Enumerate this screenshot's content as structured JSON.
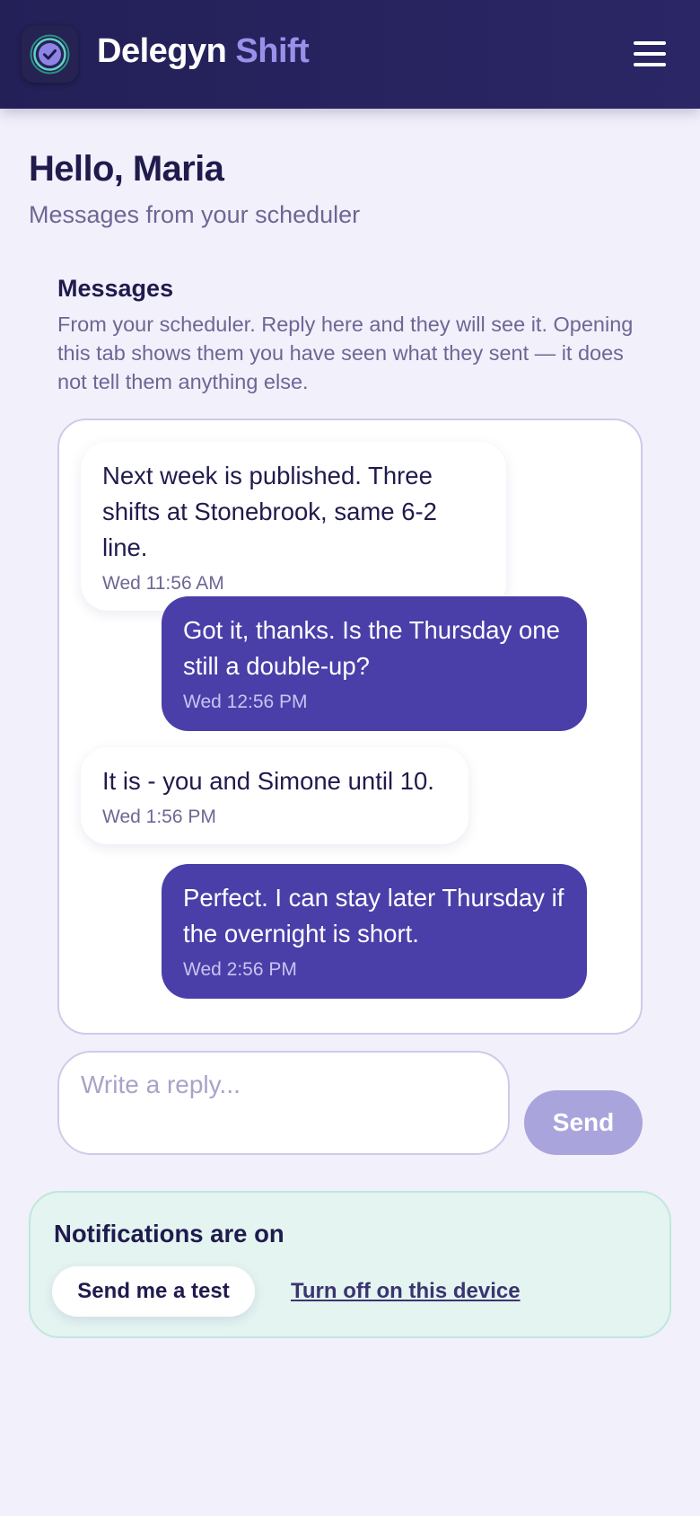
{
  "app": {
    "brand_name": "Delegyn",
    "brand_accent": "Shift",
    "logo_icon": "check-badge-icon",
    "menu_icon": "hamburger-menu-icon"
  },
  "colors": {
    "header_bg": "#231f57",
    "accent": "#9a90ea",
    "outgoing_bubble": "#4a3fa8",
    "send_button": "#aaa4dd",
    "notification_bg": "#e4f4f1"
  },
  "header": {
    "greeting": "Hello, Maria",
    "subtitle": "Messages from your scheduler"
  },
  "messages_section": {
    "title": "Messages",
    "description": "From your scheduler. Reply here and they will see it. Opening this tab shows them you have seen what they sent — it does not tell them anything else.",
    "items": [
      {
        "direction": "incoming",
        "text": "Next week is published. Three shifts at Stonebrook, same 6-2 line.",
        "time": "Wed 11:56 AM"
      },
      {
        "direction": "outgoing",
        "text": "Got it, thanks. Is the Thursday one still a double-up?",
        "time": "Wed 12:56 PM"
      },
      {
        "direction": "incoming",
        "text": "It is - you and Simone until 10.",
        "time": "Wed 1:56 PM"
      },
      {
        "direction": "outgoing",
        "text": "Perfect. I can stay later Thursday if the overnight is short.",
        "time": "Wed 2:56 PM"
      }
    ]
  },
  "reply": {
    "placeholder": "Write a reply...",
    "value": "",
    "send_label": "Send"
  },
  "notifications": {
    "title": "Notifications are on",
    "test_button_label": "Send me a test",
    "turn_off_label": "Turn off on this device"
  }
}
